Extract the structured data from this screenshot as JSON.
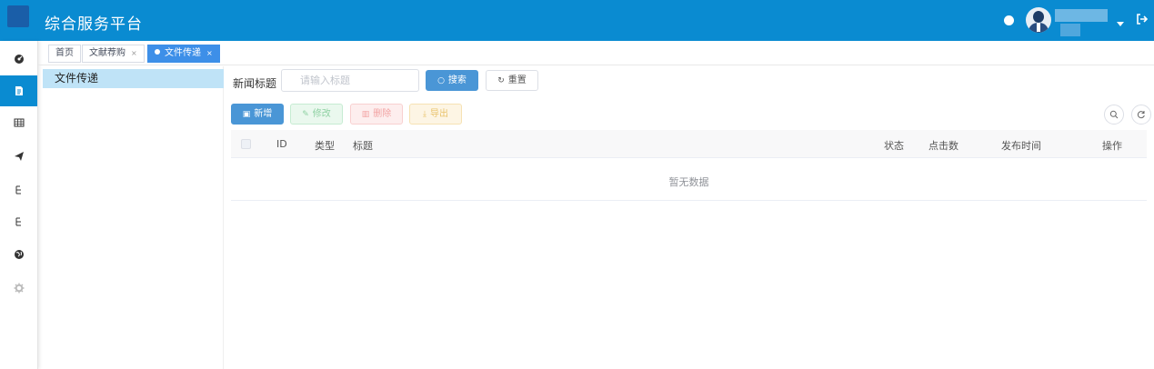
{
  "header": {
    "title": "综合服务平台",
    "logo_icon": "app-logo",
    "user_avatar_icon": "user-avatar",
    "user_menu_icon": "caret-down-icon",
    "logout_icon": "logout-icon"
  },
  "sidebar": {
    "items": [
      {
        "icon": "dashboard-icon",
        "active": false
      },
      {
        "icon": "document-icon",
        "active": true
      },
      {
        "icon": "table-icon",
        "active": false
      },
      {
        "icon": "send-icon",
        "active": false
      },
      {
        "icon": "tree-icon",
        "active": false
      },
      {
        "icon": "tree-icon",
        "active": false
      },
      {
        "icon": "globe-icon",
        "active": false
      },
      {
        "icon": "gear-icon",
        "active": false
      }
    ],
    "active_color": "#0a8bd1"
  },
  "tabs": [
    {
      "label": "首页",
      "closable": false,
      "active": false
    },
    {
      "label": "文献荐购",
      "closable": true,
      "active": false
    },
    {
      "label": "文件传递",
      "closable": true,
      "active": true
    }
  ],
  "tree": {
    "nodes": [
      {
        "label": "文件传递",
        "selected": true
      }
    ]
  },
  "search": {
    "label": "新闻标题",
    "placeholder": "请输入标题",
    "value": "",
    "search_button": "搜索",
    "reset_button": "重置"
  },
  "toolbar": {
    "add": "新增",
    "edit": "修改",
    "delete": "删除",
    "export": "导出",
    "search_toggle_icon": "search-icon",
    "refresh_icon": "refresh-icon"
  },
  "table": {
    "columns": [
      "ID",
      "类型",
      "标题",
      "状态",
      "点击数",
      "发布时间",
      "操作"
    ],
    "rows": [],
    "empty_text": "暂无数据"
  },
  "colors": {
    "header": "#0a8bd1",
    "primary": "#4a96d6",
    "active_tab": "#3d8fe8",
    "tree_selected": "#bfe3f7"
  }
}
